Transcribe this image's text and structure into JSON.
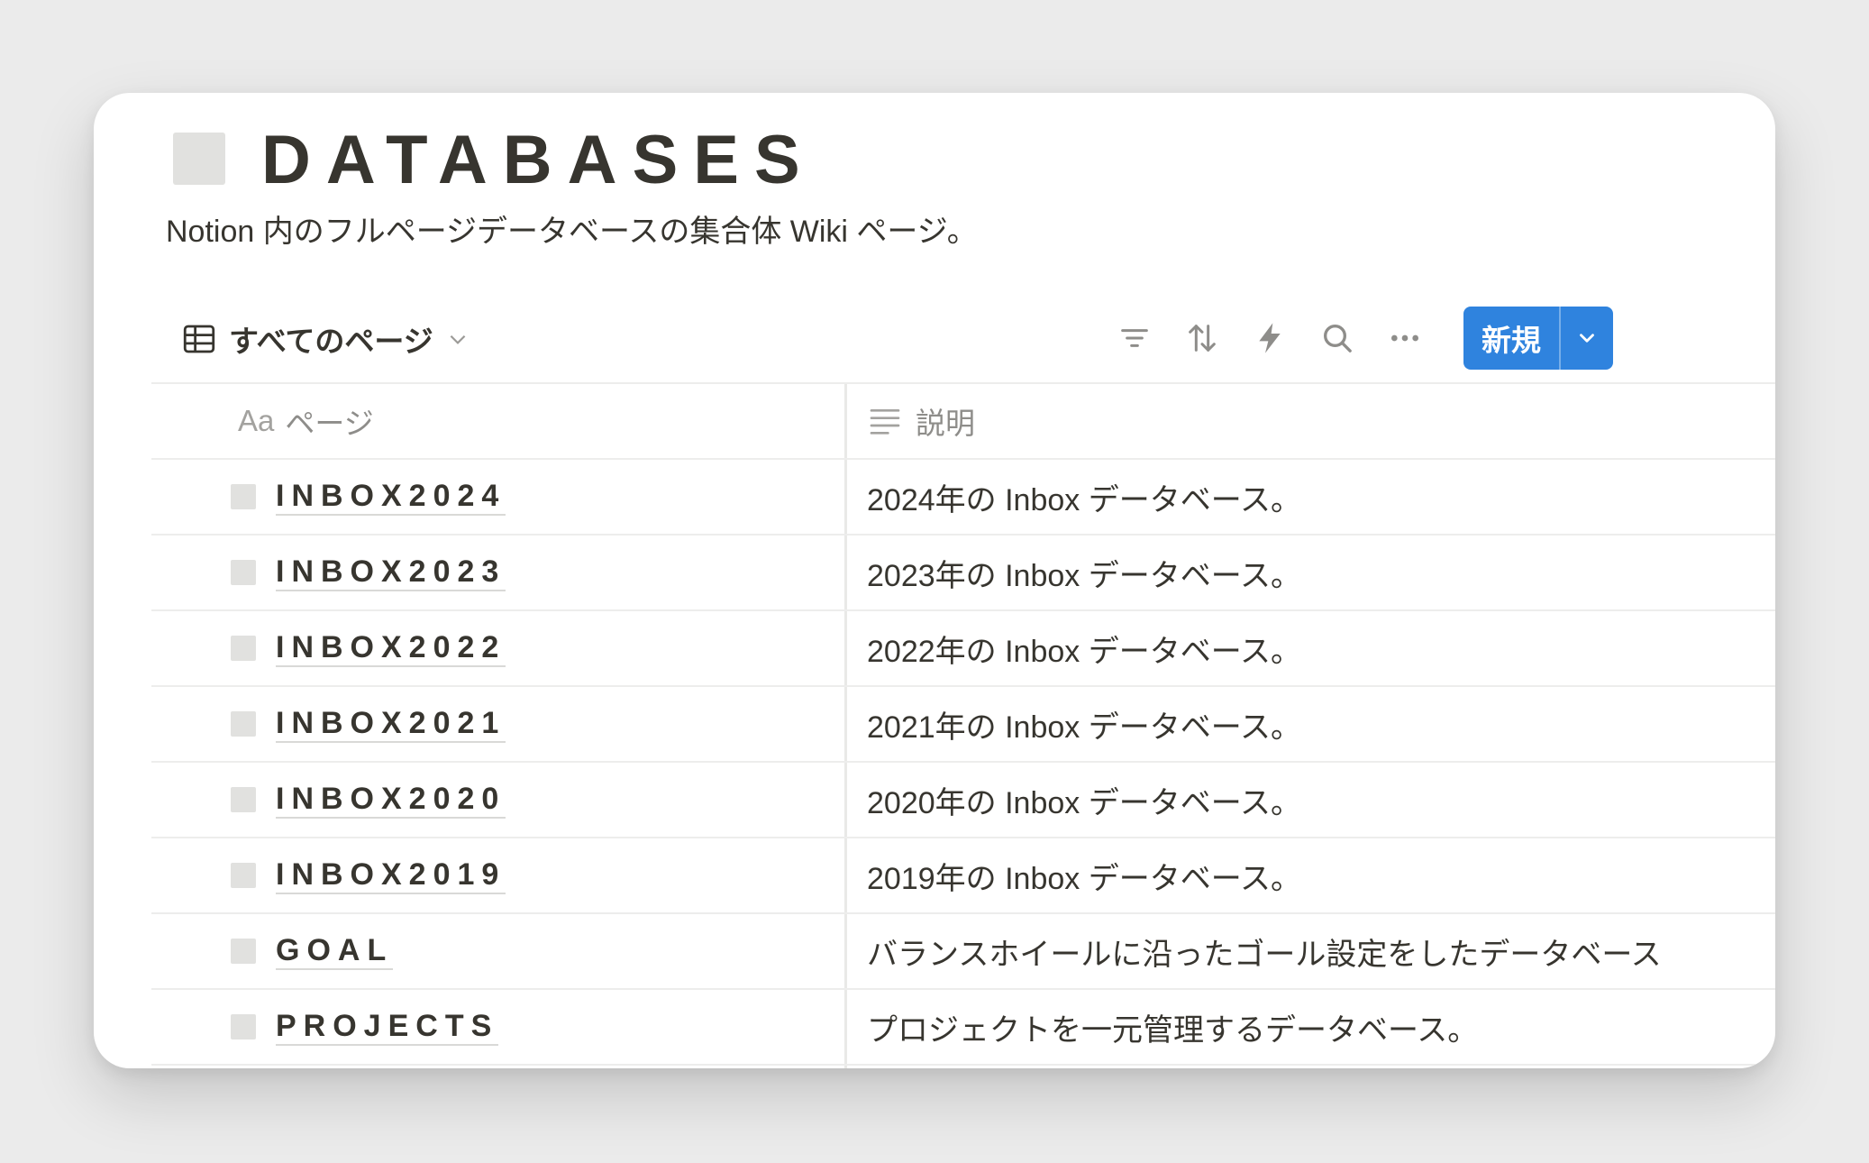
{
  "page": {
    "title": "DATABASES",
    "description": "Notion 内のフルページデータベースの集合体 Wiki ページ。",
    "icon": "page-icon-gray"
  },
  "toolbar": {
    "view_label": "すべてのページ",
    "icons": [
      "filter-icon",
      "sort-icon",
      "automation-icon",
      "search-icon",
      "more-icon"
    ],
    "new_label": "新規",
    "accent_color": "#2f83de"
  },
  "table": {
    "columns": [
      {
        "type_label": "Aa",
        "label": "ページ"
      },
      {
        "type_label": "",
        "label": "説明"
      }
    ],
    "rows": [
      {
        "title": "INBOX2024",
        "desc": "2024年の Inbox データベース。"
      },
      {
        "title": "INBOX2023",
        "desc": "2023年の Inbox データベース。"
      },
      {
        "title": "INBOX2022",
        "desc": "2022年の Inbox データベース。"
      },
      {
        "title": "INBOX2021",
        "desc": "2021年の Inbox データベース。"
      },
      {
        "title": "INBOX2020",
        "desc": "2020年の Inbox データベース。"
      },
      {
        "title": "INBOX2019",
        "desc": "2019年の Inbox データベース。"
      },
      {
        "title": "GOAL",
        "desc": "バランスホイールに沿ったゴール設定をしたデータベース"
      },
      {
        "title": "PROJECTS",
        "desc": "プロジェクトを一元管理するデータベース。"
      }
    ]
  }
}
